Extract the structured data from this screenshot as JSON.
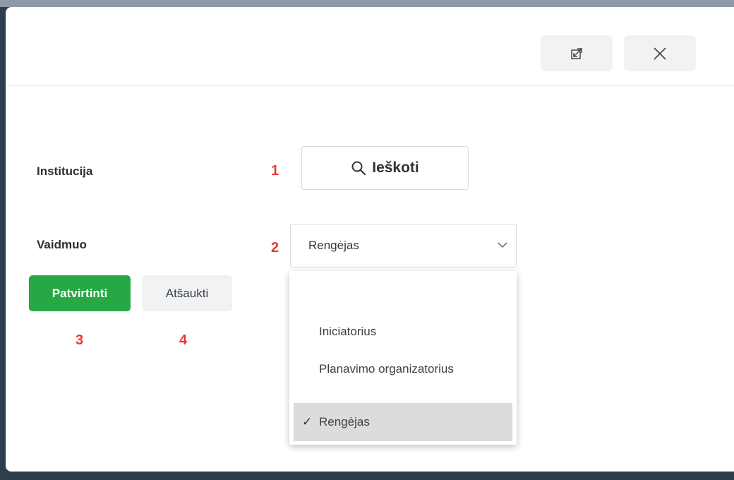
{
  "dialog": {
    "header": {
      "expand_icon": "expand-arrows-icon",
      "close_icon": "close-x-icon"
    },
    "form": {
      "institution_label": "Institucija",
      "role_label": "Vaidmuo",
      "search_button_label": "Ieškoti",
      "search_icon": "magnifier-icon",
      "role_select": {
        "selected_value": "Rengėjas",
        "options": [
          {
            "label": "Iniciatorius",
            "selected": false
          },
          {
            "label": "Planavimo organizatorius",
            "selected": false
          },
          {
            "label": "Rengėjas",
            "selected": true
          }
        ]
      },
      "confirm_label": "Patvirtinti",
      "cancel_label": "Atšaukti"
    },
    "markers": [
      "1",
      "2",
      "3",
      "4"
    ]
  },
  "colors": {
    "primary": "#28a745",
    "marker": "#e53935",
    "selected_option_bg": "#dcdcdc"
  }
}
